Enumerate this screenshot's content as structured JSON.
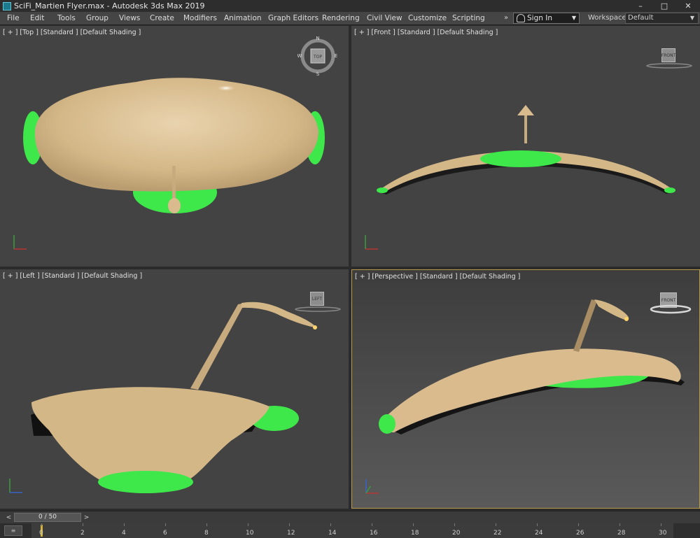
{
  "window": {
    "title": "SciFi_Martien Flyer.max - Autodesk 3ds Max 2019",
    "minimize": "–",
    "maximize": "□",
    "close": "✕"
  },
  "menu": {
    "items": [
      "File",
      "Edit",
      "Tools",
      "Group",
      "Views",
      "Create",
      "Modifiers",
      "Animation",
      "Graph Editors",
      "Rendering",
      "Civil View",
      "Customize",
      "Scripting"
    ],
    "overflow": "»",
    "sign_in": "Sign In",
    "workspaces_label": "Workspaces:",
    "workspace_value": "Default"
  },
  "viewports": {
    "top": {
      "label": "[ + ] [Top ] [Standard ] [Default Shading ]",
      "cube": "TOP"
    },
    "front": {
      "label": "[ + ] [Front ] [Standard ] [Default Shading ]",
      "cube": "FRONT"
    },
    "left": {
      "label": "[ + ] [Left ] [Standard ] [Default Shading ]",
      "cube": "LEFT"
    },
    "perspective": {
      "label": "[ + ] [Perspective ] [Standard ] [Default Shading ]",
      "cube": "FRONT",
      "active": true
    }
  },
  "compass": {
    "n": "N",
    "s": "S",
    "w": "W",
    "e": "E"
  },
  "timeline": {
    "frame_display": "0 / 50",
    "prev": "<",
    "next": ">",
    "track_icon": "≡",
    "ticks": [
      "0",
      "2",
      "4",
      "6",
      "8",
      "10",
      "12",
      "14",
      "16",
      "18",
      "20",
      "22",
      "24",
      "26",
      "28",
      "30"
    ],
    "current_frame": 0
  },
  "colors": {
    "hull": "#d9bb8e",
    "glow_green": "#3ee84a",
    "accent_active": "#b59a4a",
    "viewport_bg": "#434343"
  }
}
